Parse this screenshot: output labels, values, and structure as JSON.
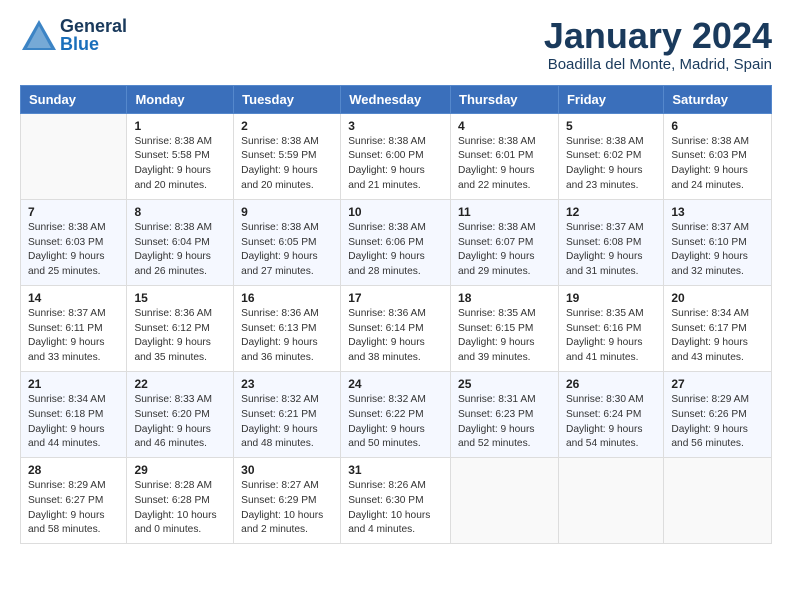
{
  "header": {
    "logo_general": "General",
    "logo_blue": "Blue",
    "month_title": "January 2024",
    "subtitle": "Boadilla del Monte, Madrid, Spain"
  },
  "days_of_week": [
    "Sunday",
    "Monday",
    "Tuesday",
    "Wednesday",
    "Thursday",
    "Friday",
    "Saturday"
  ],
  "weeks": [
    [
      {
        "day": "",
        "sunrise": "",
        "sunset": "",
        "daylight": ""
      },
      {
        "day": "1",
        "sunrise": "Sunrise: 8:38 AM",
        "sunset": "Sunset: 5:58 PM",
        "daylight": "Daylight: 9 hours and 20 minutes."
      },
      {
        "day": "2",
        "sunrise": "Sunrise: 8:38 AM",
        "sunset": "Sunset: 5:59 PM",
        "daylight": "Daylight: 9 hours and 20 minutes."
      },
      {
        "day": "3",
        "sunrise": "Sunrise: 8:38 AM",
        "sunset": "Sunset: 6:00 PM",
        "daylight": "Daylight: 9 hours and 21 minutes."
      },
      {
        "day": "4",
        "sunrise": "Sunrise: 8:38 AM",
        "sunset": "Sunset: 6:01 PM",
        "daylight": "Daylight: 9 hours and 22 minutes."
      },
      {
        "day": "5",
        "sunrise": "Sunrise: 8:38 AM",
        "sunset": "Sunset: 6:02 PM",
        "daylight": "Daylight: 9 hours and 23 minutes."
      },
      {
        "day": "6",
        "sunrise": "Sunrise: 8:38 AM",
        "sunset": "Sunset: 6:03 PM",
        "daylight": "Daylight: 9 hours and 24 minutes."
      }
    ],
    [
      {
        "day": "7",
        "sunrise": "Sunrise: 8:38 AM",
        "sunset": "Sunset: 6:03 PM",
        "daylight": "Daylight: 9 hours and 25 minutes."
      },
      {
        "day": "8",
        "sunrise": "Sunrise: 8:38 AM",
        "sunset": "Sunset: 6:04 PM",
        "daylight": "Daylight: 9 hours and 26 minutes."
      },
      {
        "day": "9",
        "sunrise": "Sunrise: 8:38 AM",
        "sunset": "Sunset: 6:05 PM",
        "daylight": "Daylight: 9 hours and 27 minutes."
      },
      {
        "day": "10",
        "sunrise": "Sunrise: 8:38 AM",
        "sunset": "Sunset: 6:06 PM",
        "daylight": "Daylight: 9 hours and 28 minutes."
      },
      {
        "day": "11",
        "sunrise": "Sunrise: 8:38 AM",
        "sunset": "Sunset: 6:07 PM",
        "daylight": "Daylight: 9 hours and 29 minutes."
      },
      {
        "day": "12",
        "sunrise": "Sunrise: 8:37 AM",
        "sunset": "Sunset: 6:08 PM",
        "daylight": "Daylight: 9 hours and 31 minutes."
      },
      {
        "day": "13",
        "sunrise": "Sunrise: 8:37 AM",
        "sunset": "Sunset: 6:10 PM",
        "daylight": "Daylight: 9 hours and 32 minutes."
      }
    ],
    [
      {
        "day": "14",
        "sunrise": "Sunrise: 8:37 AM",
        "sunset": "Sunset: 6:11 PM",
        "daylight": "Daylight: 9 hours and 33 minutes."
      },
      {
        "day": "15",
        "sunrise": "Sunrise: 8:36 AM",
        "sunset": "Sunset: 6:12 PM",
        "daylight": "Daylight: 9 hours and 35 minutes."
      },
      {
        "day": "16",
        "sunrise": "Sunrise: 8:36 AM",
        "sunset": "Sunset: 6:13 PM",
        "daylight": "Daylight: 9 hours and 36 minutes."
      },
      {
        "day": "17",
        "sunrise": "Sunrise: 8:36 AM",
        "sunset": "Sunset: 6:14 PM",
        "daylight": "Daylight: 9 hours and 38 minutes."
      },
      {
        "day": "18",
        "sunrise": "Sunrise: 8:35 AM",
        "sunset": "Sunset: 6:15 PM",
        "daylight": "Daylight: 9 hours and 39 minutes."
      },
      {
        "day": "19",
        "sunrise": "Sunrise: 8:35 AM",
        "sunset": "Sunset: 6:16 PM",
        "daylight": "Daylight: 9 hours and 41 minutes."
      },
      {
        "day": "20",
        "sunrise": "Sunrise: 8:34 AM",
        "sunset": "Sunset: 6:17 PM",
        "daylight": "Daylight: 9 hours and 43 minutes."
      }
    ],
    [
      {
        "day": "21",
        "sunrise": "Sunrise: 8:34 AM",
        "sunset": "Sunset: 6:18 PM",
        "daylight": "Daylight: 9 hours and 44 minutes."
      },
      {
        "day": "22",
        "sunrise": "Sunrise: 8:33 AM",
        "sunset": "Sunset: 6:20 PM",
        "daylight": "Daylight: 9 hours and 46 minutes."
      },
      {
        "day": "23",
        "sunrise": "Sunrise: 8:32 AM",
        "sunset": "Sunset: 6:21 PM",
        "daylight": "Daylight: 9 hours and 48 minutes."
      },
      {
        "day": "24",
        "sunrise": "Sunrise: 8:32 AM",
        "sunset": "Sunset: 6:22 PM",
        "daylight": "Daylight: 9 hours and 50 minutes."
      },
      {
        "day": "25",
        "sunrise": "Sunrise: 8:31 AM",
        "sunset": "Sunset: 6:23 PM",
        "daylight": "Daylight: 9 hours and 52 minutes."
      },
      {
        "day": "26",
        "sunrise": "Sunrise: 8:30 AM",
        "sunset": "Sunset: 6:24 PM",
        "daylight": "Daylight: 9 hours and 54 minutes."
      },
      {
        "day": "27",
        "sunrise": "Sunrise: 8:29 AM",
        "sunset": "Sunset: 6:26 PM",
        "daylight": "Daylight: 9 hours and 56 minutes."
      }
    ],
    [
      {
        "day": "28",
        "sunrise": "Sunrise: 8:29 AM",
        "sunset": "Sunset: 6:27 PM",
        "daylight": "Daylight: 9 hours and 58 minutes."
      },
      {
        "day": "29",
        "sunrise": "Sunrise: 8:28 AM",
        "sunset": "Sunset: 6:28 PM",
        "daylight": "Daylight: 10 hours and 0 minutes."
      },
      {
        "day": "30",
        "sunrise": "Sunrise: 8:27 AM",
        "sunset": "Sunset: 6:29 PM",
        "daylight": "Daylight: 10 hours and 2 minutes."
      },
      {
        "day": "31",
        "sunrise": "Sunrise: 8:26 AM",
        "sunset": "Sunset: 6:30 PM",
        "daylight": "Daylight: 10 hours and 4 minutes."
      },
      {
        "day": "",
        "sunrise": "",
        "sunset": "",
        "daylight": ""
      },
      {
        "day": "",
        "sunrise": "",
        "sunset": "",
        "daylight": ""
      },
      {
        "day": "",
        "sunrise": "",
        "sunset": "",
        "daylight": ""
      }
    ]
  ]
}
